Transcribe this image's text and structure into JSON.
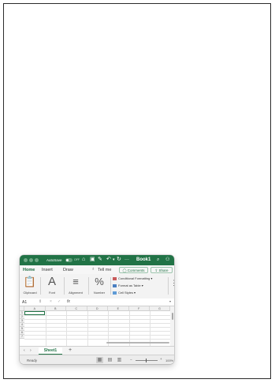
{
  "window": {
    "autosave_label": "AutoSave",
    "autosave_state": "OFF",
    "more_label": "···",
    "book_title": "Book1"
  },
  "ribbon_tabs": [
    "Home",
    "Insert",
    "Draw",
    "Tell me"
  ],
  "actions": {
    "comments": "Comments",
    "share": "Share"
  },
  "groups": {
    "clipboard": "Clipboard",
    "font": "Font",
    "alignment": "Alignment",
    "number": "Number"
  },
  "styles": [
    "Conditional Formatting",
    "Format as Table",
    "Cell Styles"
  ],
  "formula_bar": {
    "name_box": "A1",
    "fx": "fx"
  },
  "columns": [
    "A",
    "B",
    "C",
    "D",
    "E",
    "F",
    "G"
  ],
  "rows": [
    "1",
    "2",
    "3",
    "4",
    "5",
    "6",
    "7"
  ],
  "sheet": {
    "name": "Sheet1",
    "add": "+"
  },
  "status": {
    "text": "Ready",
    "zoom": "100%"
  },
  "colors": {
    "accent": "#217346"
  }
}
